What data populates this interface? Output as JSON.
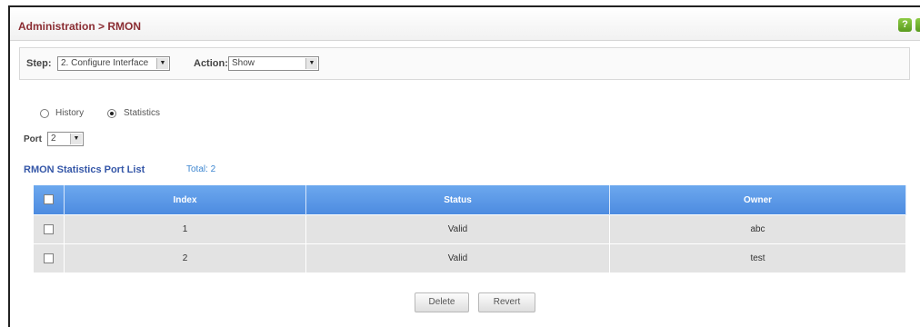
{
  "header": {
    "title": "Administration > RMON"
  },
  "toolbar": {
    "step_label": "Step:",
    "step_value": "2. Configure Interface",
    "action_label": "Action:",
    "action_value": "Show"
  },
  "options": {
    "history_label": "History",
    "statistics_label": "Statistics",
    "selected": "Statistics",
    "port_label": "Port",
    "port_value": "2"
  },
  "list": {
    "title": "RMON Statistics Port List",
    "total": "Total: 2",
    "columns": [
      "Index",
      "Status",
      "Owner"
    ],
    "rows": [
      {
        "index": "1",
        "status": "Valid",
        "owner": "abc"
      },
      {
        "index": "2",
        "status": "Valid",
        "owner": "test"
      }
    ]
  },
  "buttons": {
    "delete": "Delete",
    "revert": "Revert"
  },
  "colors": {
    "title": "#8a2c32",
    "section": "#3557a8",
    "table_header": "#5a95e6"
  }
}
